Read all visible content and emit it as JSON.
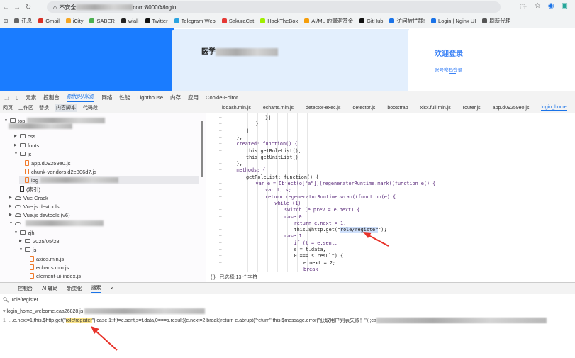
{
  "browser": {
    "url_prefix": "不安全",
    "url_suffix": "com:8000/#/login",
    "bookmarks": [
      {
        "label": "讯息",
        "color": "#666"
      },
      {
        "label": "Gmail",
        "color": "#d93025"
      },
      {
        "label": "iCity",
        "color": "#f5a623"
      },
      {
        "label": "SABER",
        "color": "#4caf50"
      },
      {
        "label": "wiali",
        "color": "#222"
      },
      {
        "label": "Twitter",
        "color": "#111"
      },
      {
        "label": "Telegram Web",
        "color": "#2aa3e0"
      },
      {
        "label": "SakuraCat",
        "color": "#e53935"
      },
      {
        "label": "HackTheBox",
        "color": "#9fef00"
      },
      {
        "label": "AI/ML 的漏洞赏金",
        "color": "#f59e0b"
      },
      {
        "label": "GitHub",
        "color": "#111"
      },
      {
        "label": "访问被拦截!",
        "color": "#1a73e8"
      },
      {
        "label": "Login | Nginx UI",
        "color": "#1a73e8"
      },
      {
        "label": "刷新代理",
        "color": "#555"
      }
    ]
  },
  "page": {
    "site_title": "医学",
    "welcome": "欢迎登录",
    "login_tab": "账号密码登录",
    "colors": {
      "blue": "#1a7cff",
      "light": "#e3effd",
      "accent": "#3b82f6"
    }
  },
  "devtools": {
    "tabs": [
      "元素",
      "控制台",
      "源代码/来源",
      "网络",
      "性能",
      "Lighthouse",
      "内存",
      "应用",
      "Cookie-Editor"
    ],
    "active_tab": "源代码/来源",
    "subtabs": [
      "网页",
      "工作区",
      "替换",
      "内容脚本",
      "代码段"
    ],
    "file_tabs": [
      "lodash.min.js",
      "echarts.min.js",
      "detector-exec.js",
      "detector.js",
      "bootstrap",
      "xlsx.full.min.js",
      "router.js",
      "app.d09259e0.js",
      "login_home"
    ],
    "tree": [
      {
        "label": "top",
        "type": "frame",
        "depth": 0,
        "open": true
      },
      {
        "label": "css",
        "type": "folder",
        "depth": 2,
        "open": false
      },
      {
        "label": "fonts",
        "type": "folder",
        "depth": 2,
        "open": false
      },
      {
        "label": "js",
        "type": "folder",
        "depth": 2,
        "open": true
      },
      {
        "label": "app.d09259e0.js",
        "type": "file",
        "depth": 3
      },
      {
        "label": "chunk-vendors.d2e306d7.js",
        "type": "file",
        "depth": 3
      },
      {
        "label": "log",
        "type": "file",
        "depth": 3,
        "selected": true
      },
      {
        "label": "(索引)",
        "type": "doc",
        "depth": 2
      },
      {
        "label": "Vue Crack",
        "type": "cloud",
        "depth": 1,
        "open": false
      },
      {
        "label": "Vue.js devtools",
        "type": "cloud",
        "depth": 1,
        "open": false
      },
      {
        "label": "Vue.js devtools (v6)",
        "type": "cloud",
        "depth": 1,
        "open": false
      },
      {
        "label": "",
        "type": "cloud",
        "depth": 1,
        "open": true
      },
      {
        "label": "zjh",
        "type": "folder",
        "depth": 2,
        "open": true
      },
      {
        "label": "2025/05/28",
        "type": "folder",
        "depth": 3,
        "open": false
      },
      {
        "label": "js",
        "type": "folder",
        "depth": 3,
        "open": true
      },
      {
        "label": "axios.min.js",
        "type": "file",
        "depth": 4
      },
      {
        "label": "echarts.min.js",
        "type": "file",
        "depth": 4
      },
      {
        "label": "element-ui-index.js",
        "type": "file",
        "depth": 4
      }
    ],
    "code": [
      {
        "i": 6,
        "t": "}]"
      },
      {
        "i": 5,
        "t": "}"
      },
      {
        "i": 4,
        "t": "]"
      },
      {
        "i": 3,
        "t": "},"
      },
      {
        "i": 3,
        "t": "created: function() {"
      },
      {
        "i": 4,
        "t": "this.getRoleList(),"
      },
      {
        "i": 4,
        "t": "this.getUnitList()"
      },
      {
        "i": 3,
        "t": "},"
      },
      {
        "i": 3,
        "t": "methods: {"
      },
      {
        "i": 4,
        "t": "getRoleList: function() {"
      },
      {
        "i": 5,
        "t": "var e = Object(o[\"a\"])(regeneratorRuntime.mark((function e() {"
      },
      {
        "i": 6,
        "t": "var t, s;"
      },
      {
        "i": 6,
        "t": "return regeneratorRuntime.wrap((function(e) {"
      },
      {
        "i": 7,
        "t": "while (1)"
      },
      {
        "i": 8,
        "t": "switch (e.prev = e.next) {"
      },
      {
        "i": 8,
        "t": "case 0:"
      },
      {
        "i": 9,
        "t": "return e.next = 1,"
      },
      {
        "i": 9,
        "t": "this.$http.get(\"role/register\");",
        "hl": "role/register"
      },
      {
        "i": 8,
        "t": "case 1:"
      },
      {
        "i": 9,
        "t": "if (t = e.sent,"
      },
      {
        "i": 9,
        "t": "s = t.data,"
      },
      {
        "i": 9,
        "t": "0 === s.result) {"
      },
      {
        "i": 10,
        "t": "e.next = 2;"
      },
      {
        "i": 10,
        "t": "break"
      }
    ],
    "status": "已选择 13 个字符",
    "drawer_tabs": [
      "控制台",
      "AI 辅助",
      "新变化",
      "搜索"
    ],
    "active_drawer": "搜索",
    "search_query": "role/register",
    "result_file": "login_home_welcome.eaa26828.js",
    "result_line_no": "1",
    "result_pre": "…e.next=1,this.$http.get(\"",
    "result_match": "role/register",
    "result_post": "\");case 1:if(t=e.sent,s=t.data,0===s.result){e.next=2;break}return e.abrupt(\"return\",this.$message.error(\"获取用户列表失败！\"));ca"
  }
}
